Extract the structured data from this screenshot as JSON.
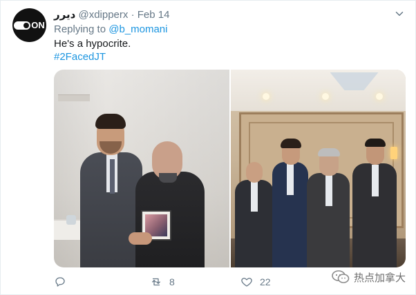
{
  "tweet": {
    "display_name": "دیرر",
    "handle": "@xdipperx",
    "separator": "·",
    "date": "Feb 14",
    "replying_prefix": "Replying to",
    "replying_to": "@b_momani",
    "text": "He's a hypocrite.",
    "hashtag": "#2FacedJT"
  },
  "avatar": {
    "logo_text": "ON"
  },
  "icons": {
    "caret": "chevron-down-icon",
    "reply": "reply-icon",
    "retweet": "retweet-icon",
    "like": "heart-icon",
    "watermark": "wechat-icon"
  },
  "actions": {
    "reply_count": "",
    "retweet_count": "8",
    "like_count": "22"
  },
  "watermark": {
    "text": "热点加拿大"
  },
  "colors": {
    "link": "#1b95e0",
    "muted": "#657786",
    "text": "#14171a"
  }
}
